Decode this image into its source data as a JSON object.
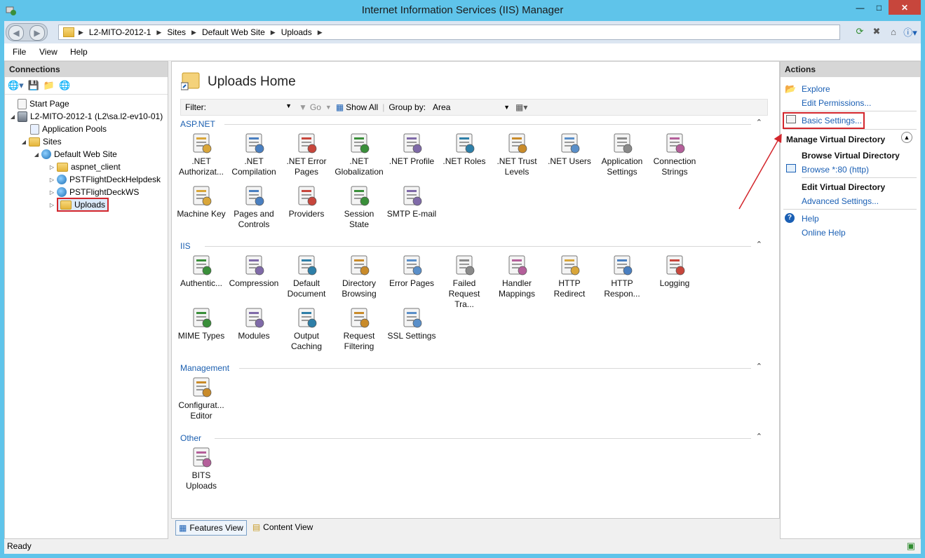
{
  "window": {
    "title": "Internet Information Services (IIS) Manager"
  },
  "address": {
    "crumbs": [
      "L2-MITO-2012-1",
      "Sites",
      "Default Web Site",
      "Uploads"
    ]
  },
  "menu": [
    "File",
    "View",
    "Help"
  ],
  "connections": {
    "header": "Connections",
    "tree": [
      {
        "label": "Start Page",
        "icon": "start-page-icon"
      },
      {
        "label": "L2-MITO-2012-1 (L2\\sa.l2-ev10-01)",
        "icon": "server-icon"
      },
      {
        "label": "Application Pools",
        "icon": "app-pools-icon"
      },
      {
        "label": "Sites",
        "icon": "sites-icon"
      },
      {
        "label": "Default Web Site",
        "icon": "globe-icon"
      },
      {
        "label": "aspnet_client",
        "icon": "folder-icon"
      },
      {
        "label": "PSTFlightDeckHelpdesk",
        "icon": "globe-icon"
      },
      {
        "label": "PSTFlightDeckWS",
        "icon": "globe-icon"
      },
      {
        "label": "Uploads",
        "icon": "virtual-dir-icon"
      }
    ]
  },
  "center": {
    "title": "Uploads Home",
    "filter_label": "Filter:",
    "go_label": "Go",
    "show_all_label": "Show All",
    "group_by_label": "Group by:",
    "group_by_value": "Area",
    "sections": [
      {
        "name": "ASP.NET",
        "items": [
          ".NET Authorizat...",
          ".NET Compilation",
          ".NET Error Pages",
          ".NET Globalization",
          ".NET Profile",
          ".NET Roles",
          ".NET Trust Levels",
          ".NET Users",
          "Application Settings",
          "Connection Strings",
          "Machine Key",
          "Pages and Controls",
          "Providers",
          "Session State",
          "SMTP E-mail"
        ]
      },
      {
        "name": "IIS",
        "items": [
          "Authentic...",
          "Compression",
          "Default Document",
          "Directory Browsing",
          "Error Pages",
          "Failed Request Tra...",
          "Handler Mappings",
          "HTTP Redirect",
          "HTTP Respon...",
          "Logging",
          "MIME Types",
          "Modules",
          "Output Caching",
          "Request Filtering",
          "SSL Settings"
        ]
      },
      {
        "name": "Management",
        "items": [
          "Configurat... Editor"
        ]
      },
      {
        "name": "Other",
        "items": [
          "BITS Uploads"
        ]
      }
    ],
    "view_tabs": [
      "Features View",
      "Content View"
    ]
  },
  "actions": {
    "header": "Actions",
    "explore": "Explore",
    "edit_permissions": "Edit Permissions...",
    "basic_settings": "Basic Settings...",
    "manage_header": "Manage Virtual Directory",
    "browse_header": "Browse Virtual Directory",
    "browse_link": "Browse *:80 (http)",
    "edit_header": "Edit Virtual Directory",
    "advanced_settings": "Advanced Settings...",
    "help": "Help",
    "online_help": "Online Help"
  },
  "status": {
    "text": "Ready"
  },
  "colors": {
    "highlight": "#d3262c",
    "link": "#1a5fb4",
    "titlebar": "#5fc4ea"
  }
}
